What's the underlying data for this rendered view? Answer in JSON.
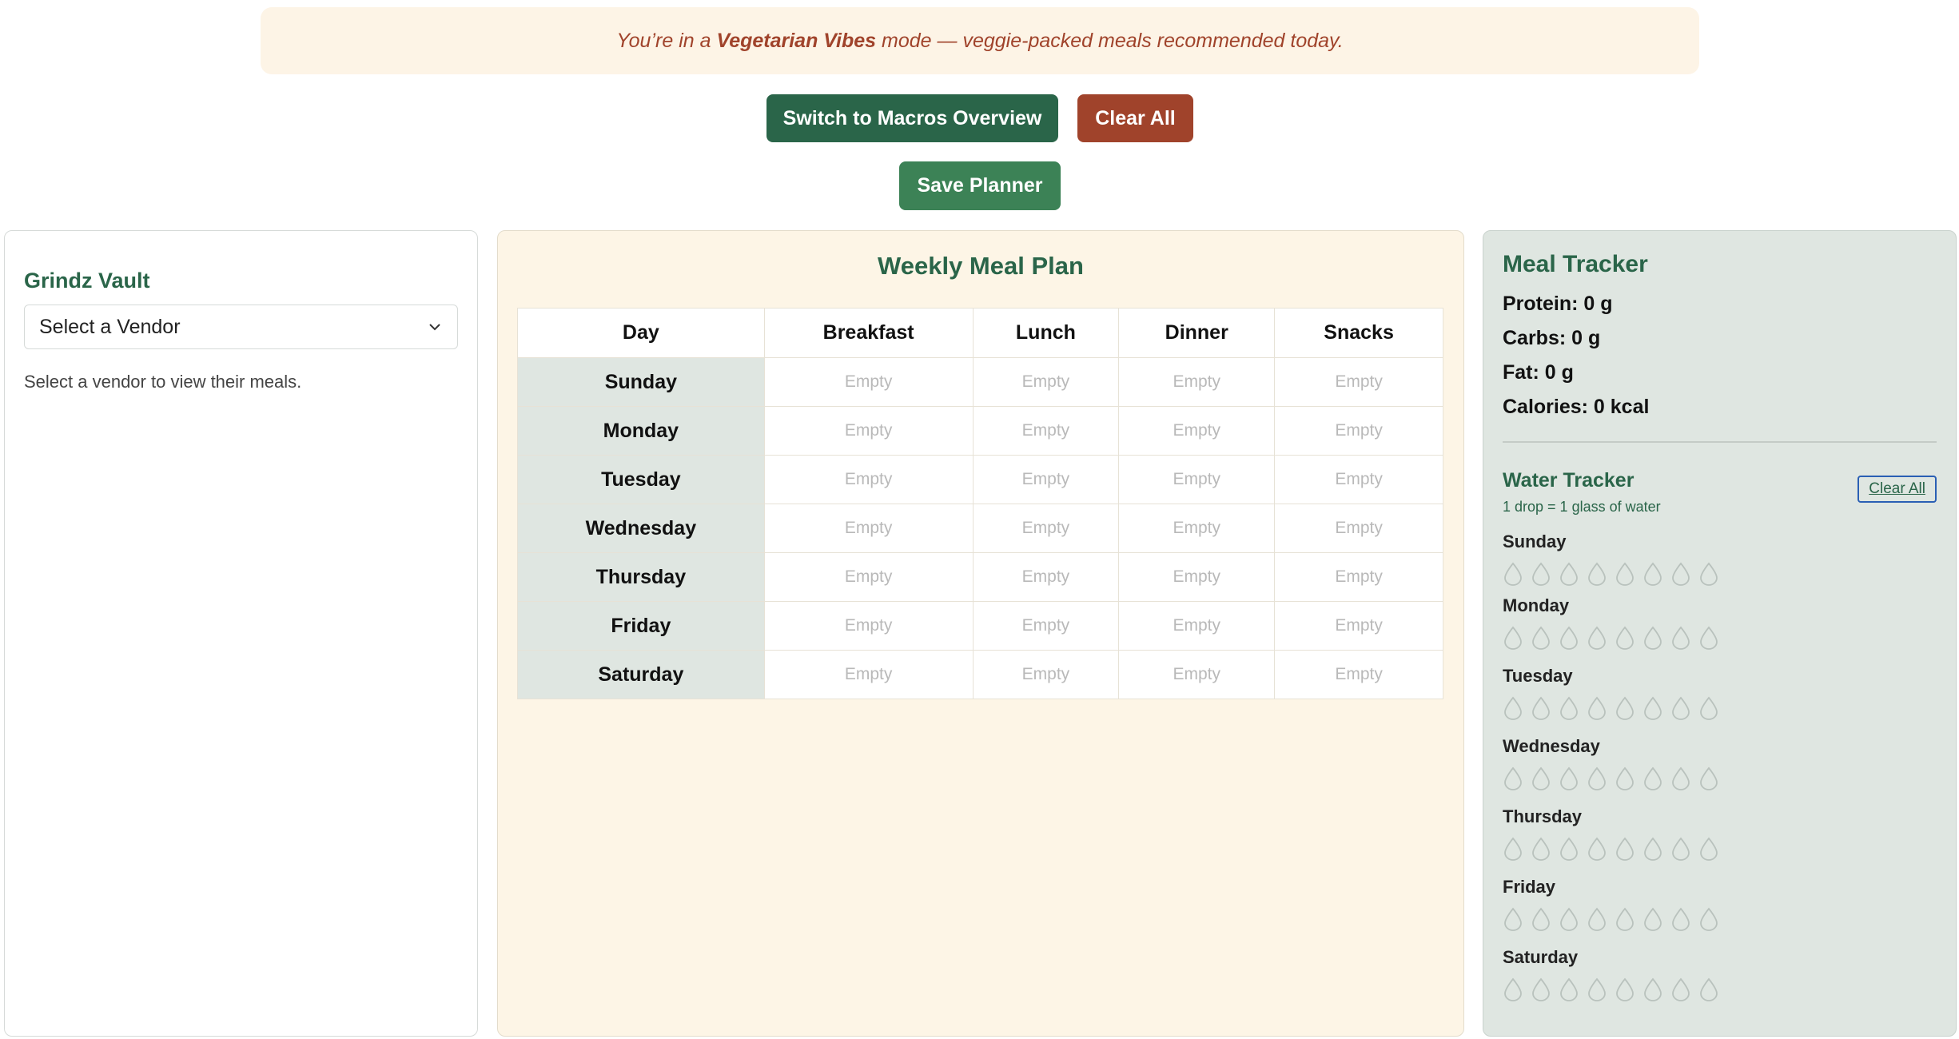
{
  "banner": {
    "prefix": "You’re in a ",
    "mode": "Vegetarian Vibes",
    "suffix": " mode — veggie-packed meals recommended today."
  },
  "buttons": {
    "macros": "Switch to Macros Overview",
    "clear_all": "Clear All",
    "save": "Save Planner"
  },
  "vault": {
    "title": "Grindz Vault",
    "select_value": "Select a Vendor",
    "hint": "Select a vendor to view their meals."
  },
  "plan": {
    "title": "Weekly Meal Plan",
    "headers": [
      "Day",
      "Breakfast",
      "Lunch",
      "Dinner",
      "Snacks"
    ],
    "empty_label": "Empty",
    "days": [
      "Sunday",
      "Monday",
      "Tuesday",
      "Wednesday",
      "Thursday",
      "Friday",
      "Saturday"
    ]
  },
  "tracker": {
    "title": "Meal Tracker",
    "protein": "Protein: 0 g",
    "carbs": "Carbs: 0 g",
    "fat": "Fat: 0 g",
    "calories": "Calories: 0 kcal",
    "water_title": "Water Tracker",
    "water_sub": "1 drop = 1 glass of water",
    "clear_all": "Clear All",
    "days": [
      "Sunday",
      "Monday",
      "Tuesday",
      "Wednesday",
      "Thursday",
      "Friday",
      "Saturday"
    ],
    "drops_per_day": 8,
    "drops_filled": [
      0,
      0,
      0,
      0,
      0,
      0,
      0
    ]
  },
  "colors": {
    "primary_green": "#2a6549",
    "save_green": "#3c8256",
    "brick": "#a0432b",
    "cream": "#fdf5e6",
    "sage": "#dfe6e1"
  }
}
